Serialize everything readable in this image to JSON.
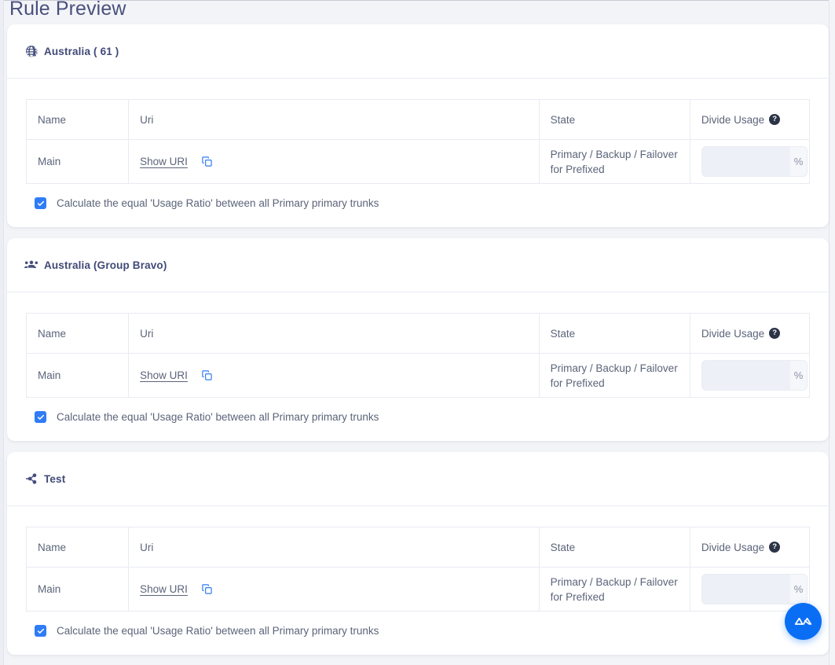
{
  "page": {
    "title": "Rule Preview",
    "accent_color": "#2f7cf6",
    "fab_color": "#0a6ef5",
    "background_color": "#f3f4f8",
    "title_color": "#49507c"
  },
  "table_columns": [
    "Name",
    "Uri",
    "State",
    "Divide Usage"
  ],
  "help_icon_glyph": "?",
  "cards": [
    {
      "icon": "globe-icon",
      "title": "Australia ( 61 )",
      "rows": [
        {
          "name": "Main",
          "uri_link": "Show URI",
          "copy_icon": "copy-icon",
          "state": "Primary / Backup / Failover for Prefixed",
          "usage_value": "",
          "usage_placeholder": "",
          "usage_suffix": "%"
        }
      ],
      "ratio_checkbox": {
        "checked": true,
        "label": "Calculate the equal 'Usage Ratio' between all Primary primary trunks"
      }
    },
    {
      "icon": "users-group-icon",
      "title": "Australia (Group Bravo)",
      "rows": [
        {
          "name": "Main",
          "uri_link": "Show URI",
          "copy_icon": "copy-icon",
          "state": "Primary / Backup / Failover for Prefixed",
          "usage_value": "",
          "usage_placeholder": "",
          "usage_suffix": "%"
        }
      ],
      "ratio_checkbox": {
        "checked": true,
        "label": "Calculate the equal 'Usage Ratio' between all Primary primary trunks"
      }
    },
    {
      "icon": "share-nodes-icon",
      "title": "Test",
      "rows": [
        {
          "name": "Main",
          "uri_link": "Show URI",
          "copy_icon": "copy-icon",
          "state": "Primary / Backup / Failover for Prefixed",
          "usage_value": "",
          "usage_placeholder": "",
          "usage_suffix": "%"
        }
      ],
      "ratio_checkbox": {
        "checked": true,
        "label": "Calculate the equal 'Usage Ratio' between all Primary primary trunks"
      }
    }
  ],
  "fab": {
    "name": "assistant-fab",
    "icon": "peaks-logo-icon"
  }
}
